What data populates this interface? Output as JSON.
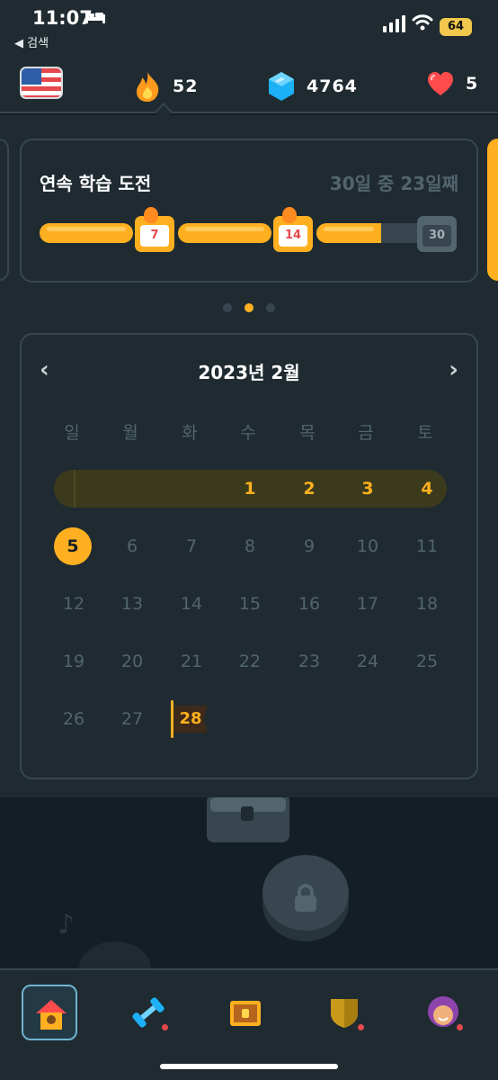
{
  "status_bar": {
    "time": "11:07",
    "back_label": "◀ 검색",
    "battery": "64"
  },
  "top_bar": {
    "streak_count": "52",
    "gems_count": "4764",
    "hearts_count": "5"
  },
  "challenge": {
    "title": "연속 학습 도전",
    "progress_text": "30일 중 23일째",
    "progress": 0.77,
    "milestones": [
      "7",
      "14",
      "30"
    ]
  },
  "carousel": {
    "active_index": 1,
    "count": 3
  },
  "calendar": {
    "month_title": "2023년 2월",
    "weekdays": [
      "일",
      "월",
      "화",
      "수",
      "목",
      "금",
      "토"
    ],
    "streak_days": [
      "1",
      "2",
      "3",
      "4"
    ],
    "today": "5",
    "week2": [
      "6",
      "7",
      "8",
      "9",
      "10",
      "11"
    ],
    "week3": [
      "12",
      "13",
      "14",
      "15",
      "16",
      "17",
      "18"
    ],
    "week4": [
      "19",
      "20",
      "21",
      "22",
      "23",
      "24",
      "25"
    ],
    "week5": [
      "26",
      "27"
    ],
    "goal_day": "28"
  },
  "colors": {
    "accent": "#ffb020",
    "background": "#131f24",
    "panel": "#1f2b31",
    "border": "#37464f",
    "muted_text": "#52656d"
  }
}
